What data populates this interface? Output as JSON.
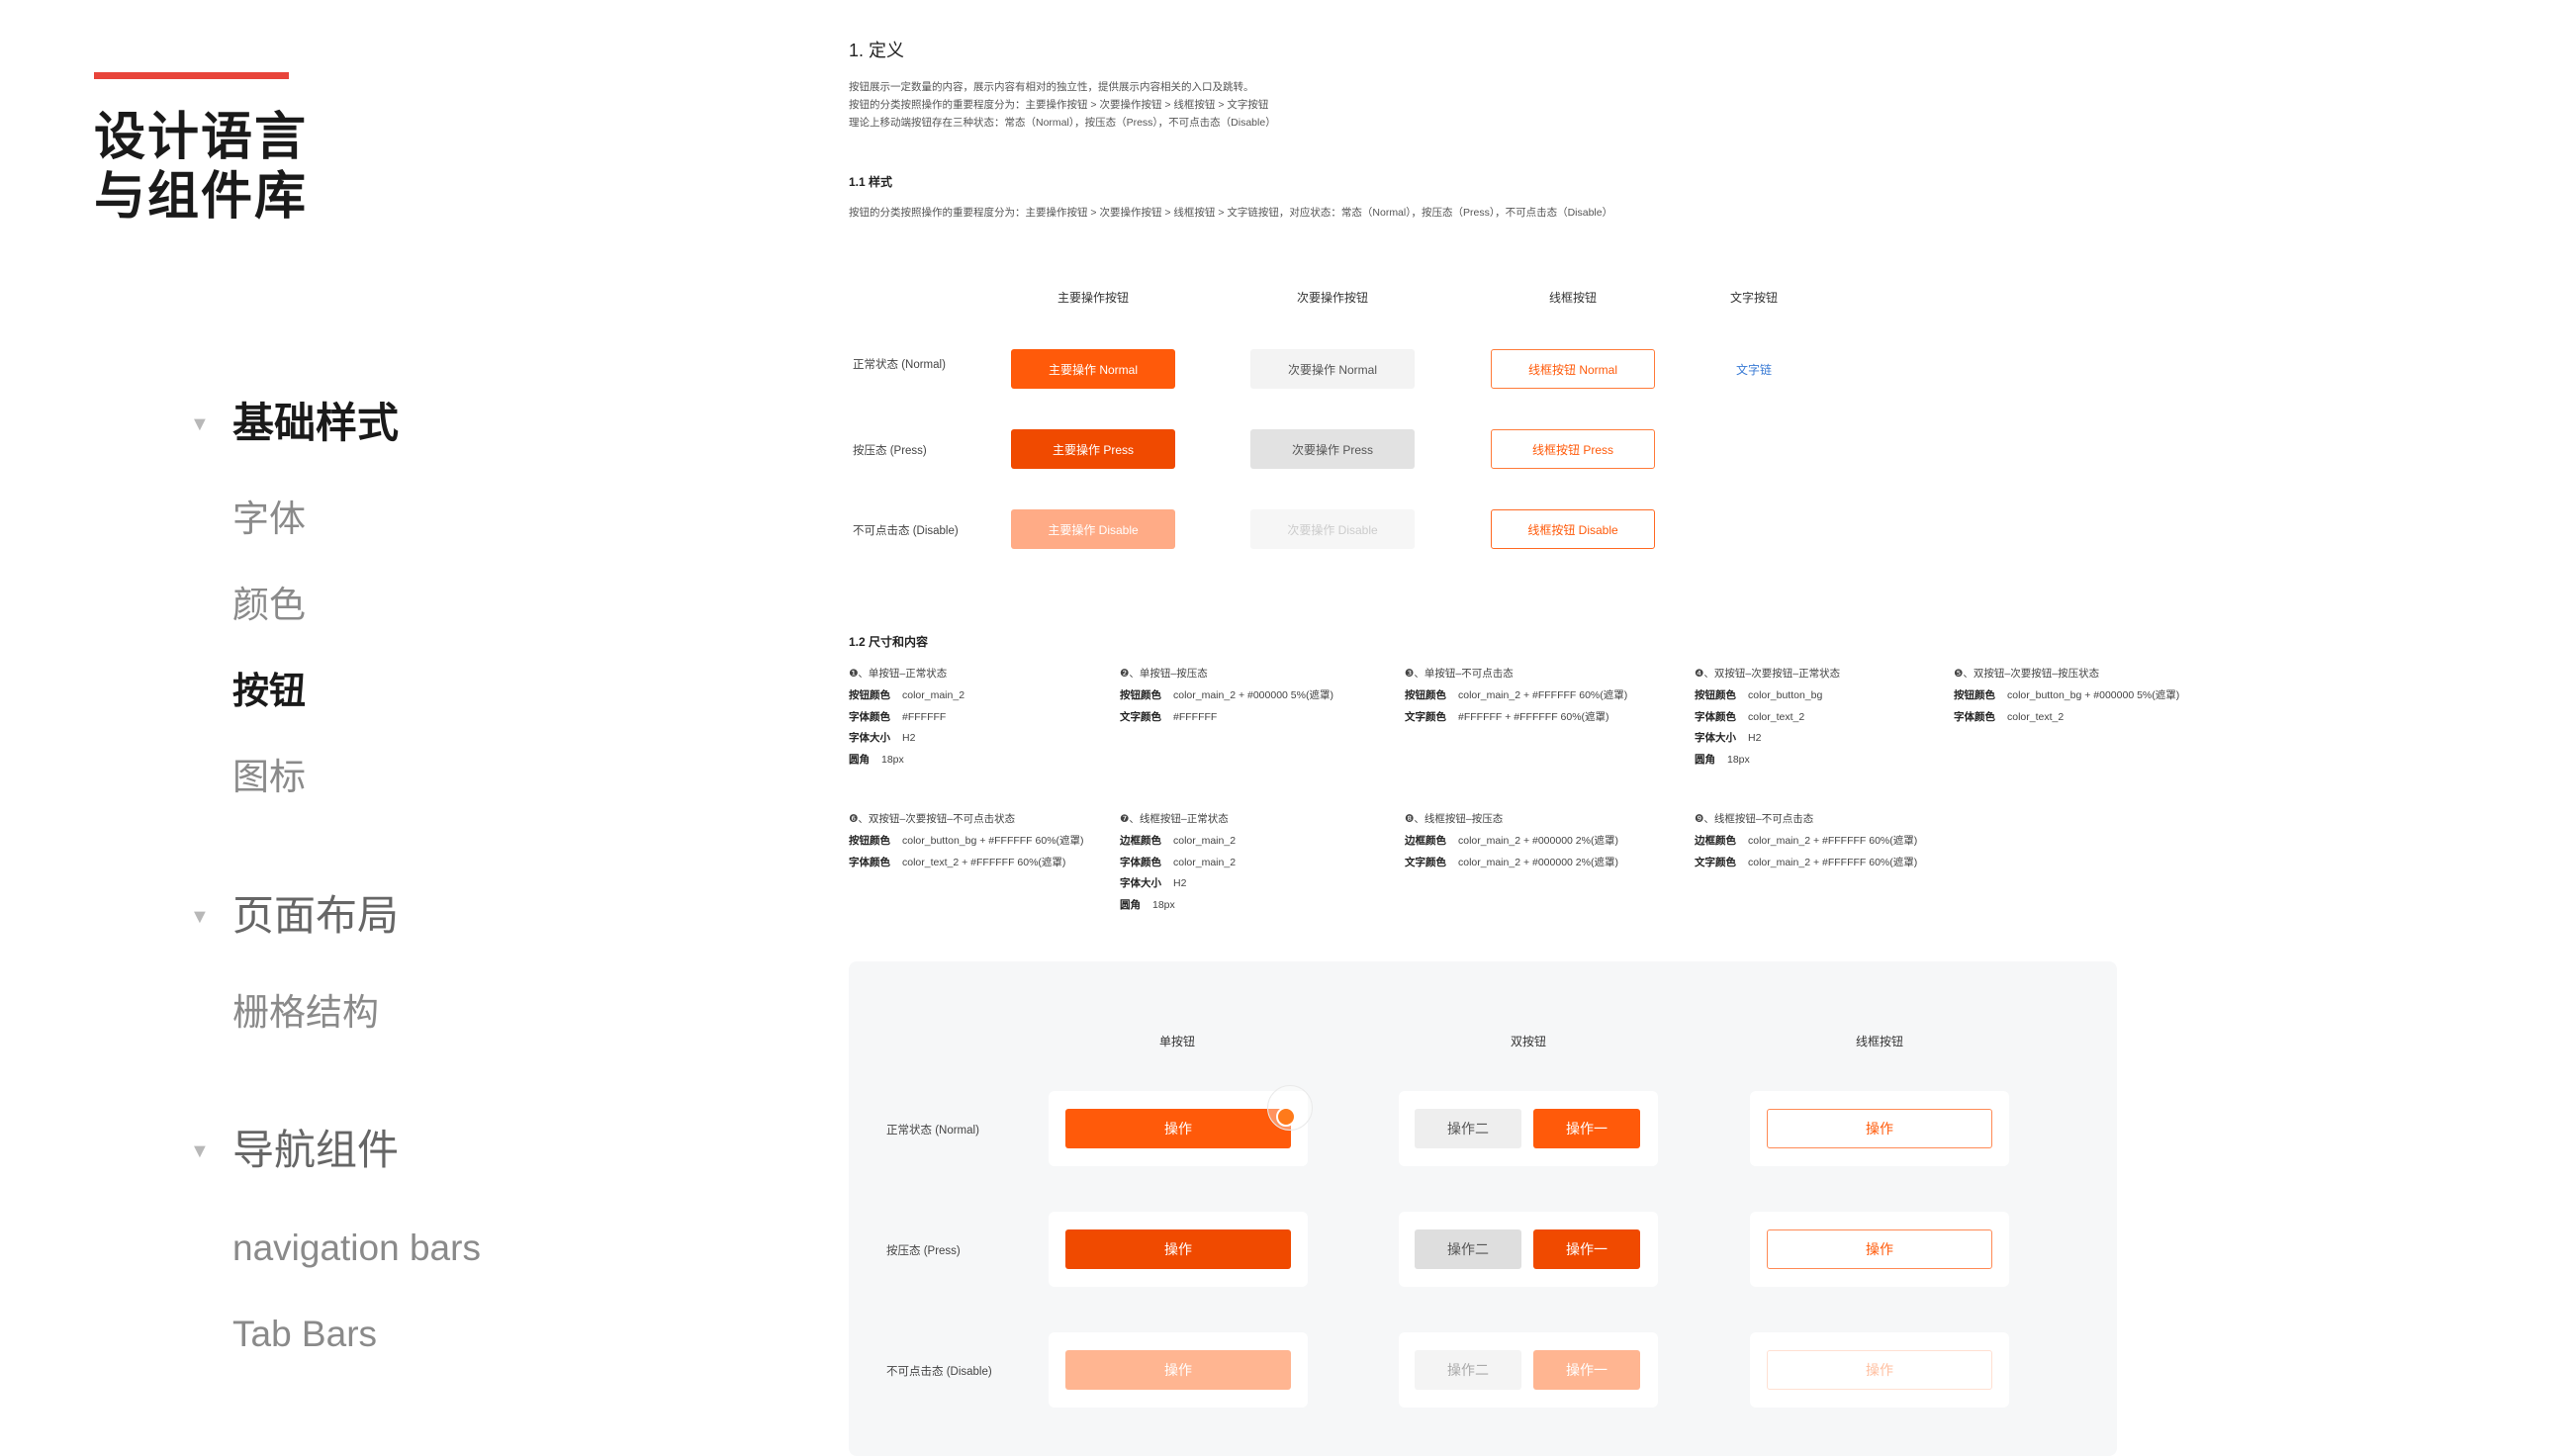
{
  "sidebar": {
    "brand_line1": "设计语言",
    "brand_line2": "与组件库",
    "sections": [
      {
        "label": "基础样式",
        "items": [
          "字体",
          "颜色",
          "按钮",
          "图标"
        ]
      },
      {
        "label": "页面布局",
        "items": [
          "栅格结构"
        ]
      },
      {
        "label": "导航组件",
        "items": [
          "navigation bars",
          "Tab Bars"
        ]
      }
    ],
    "arrow": "▼"
  },
  "content": {
    "def_title": "1. 定义",
    "def_lines": [
      "按钮展示一定数量的内容，展示内容有相对的独立性，提供展示内容相关的入口及跳转。",
      "按钮的分类按照操作的重要程度分为：主要操作按钮 > 次要操作按钮 > 线框按钮 > 文字按钮",
      "理论上移动端按钮存在三种状态：常态（Normal），按压态（Press），不可点击态（Disable）"
    ],
    "style_title": "1.1 样式",
    "style_line": "按钮的分类按照操作的重要程度分为：主要操作按钮 > 次要操作按钮 > 线框按钮 > 文字链按钮，对应状态：常态（Normal），按压态（Press），不可点击态（Disable）",
    "columns": [
      "主要操作按钮",
      "次要操作按钮",
      "线框按钮",
      "文字按钮"
    ],
    "rows": [
      "正常状态 (Normal)",
      "按压态 (Press)",
      "不可点击态 (Disable)"
    ],
    "buttons": {
      "primary": [
        "主要操作 Normal",
        "主要操作 Press",
        "主要操作 Disable"
      ],
      "secondary": [
        "次要操作 Normal",
        "次要操作 Press",
        "次要操作 Disable"
      ],
      "outline": [
        "线框按钮 Normal",
        "线框按钮 Press",
        "线框按钮  Disable"
      ],
      "text": "文字链"
    },
    "size_title": "1.2 尺寸和内容",
    "specs": [
      {
        "title": "❶、单按钮–正常状态",
        "lines": [
          [
            "按钮颜色",
            "color_main_2"
          ],
          [
            "字体颜色",
            "#FFFFFF"
          ],
          [
            "字体大小",
            "H2"
          ],
          [
            "圆角",
            "18px"
          ]
        ]
      },
      {
        "title": "❷、单按钮–按压态",
        "lines": [
          [
            "按钮颜色",
            "color_main_2 + #000000 5%(遮罩)"
          ],
          [
            "文字颜色",
            "#FFFFFF"
          ]
        ]
      },
      {
        "title": "❸、单按钮–不可点击态",
        "lines": [
          [
            "按钮颜色",
            "color_main_2 + #FFFFFF 60%(遮罩)"
          ],
          [
            "文字颜色",
            "#FFFFFF + #FFFFFF 60%(遮罩)"
          ]
        ]
      },
      {
        "title": "❹、双按钮–次要按钮–正常状态",
        "lines": [
          [
            "按钮颜色",
            "color_button_bg"
          ],
          [
            "字体颜色",
            "color_text_2"
          ],
          [
            "字体大小",
            "H2"
          ],
          [
            "圆角",
            "18px"
          ]
        ]
      },
      {
        "title": "❺、双按钮–次要按钮–按压状态",
        "lines": [
          [
            "按钮颜色",
            "color_button_bg + #000000 5%(遮罩)"
          ],
          [
            "字体颜色",
            "color_text_2"
          ]
        ]
      },
      {
        "title": "❻、双按钮–次要按钮–不可点击状态",
        "lines": [
          [
            "按钮颜色",
            "color_button_bg + #FFFFFF 60%(遮罩)"
          ],
          [
            "字体颜色",
            "color_text_2 + #FFFFFF 60%(遮罩)"
          ]
        ]
      },
      {
        "title": "❼、线框按钮–正常状态",
        "lines": [
          [
            "边框颜色",
            "color_main_2"
          ],
          [
            "字体颜色",
            "color_main_2"
          ],
          [
            "字体大小",
            "H2"
          ],
          [
            "圆角",
            "18px"
          ]
        ]
      },
      {
        "title": "❽、线框按钮–按压态",
        "lines": [
          [
            "边框颜色",
            "color_main_2 + #000000 2%(遮罩)"
          ],
          [
            "文字颜色",
            "color_main_2 + #000000 2%(遮罩)"
          ]
        ]
      },
      {
        "title": "❾、线框按钮–不可点击态",
        "lines": [
          [
            "边框颜色",
            "color_main_2 + #FFFFFF 60%(遮罩)"
          ],
          [
            "文字颜色",
            "color_main_2 + #FFFFFF 60%(遮罩)"
          ]
        ]
      }
    ],
    "panel": {
      "columns": [
        "单按钮",
        "双按钮",
        "线框按钮"
      ],
      "rows": [
        "正常状态 (Normal)",
        "按压态 (Press)",
        "不可点击态 (Disable)"
      ],
      "single": "操作",
      "double_secondary": "操作二",
      "double_primary": "操作一",
      "outline": "操作"
    }
  },
  "colors": {
    "accent": "#ff5a0a",
    "red_bar": "#e8443a",
    "text_link": "#3a7bd5"
  }
}
